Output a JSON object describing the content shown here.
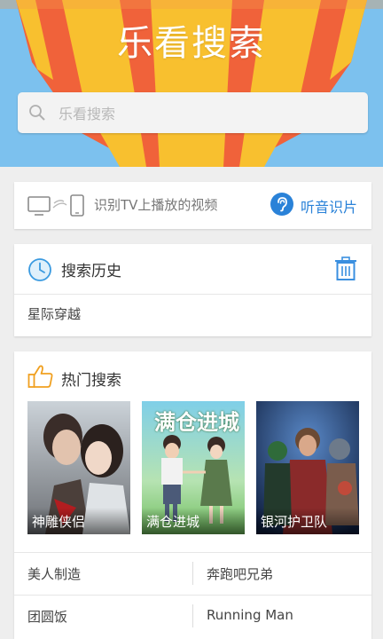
{
  "header": {
    "app_title": "乐看搜索",
    "search_placeholder": "乐看搜索"
  },
  "tv_card": {
    "text": "识别TV上播放的视频",
    "listen_label": "听音识片"
  },
  "history": {
    "title": "搜索历史",
    "items": [
      "星际穿越"
    ]
  },
  "hot": {
    "title": "热门搜索",
    "posters": [
      {
        "caption": "神雕侠侣"
      },
      {
        "caption": "满仓进城",
        "logo_text": "满仓进城"
      },
      {
        "caption": "银河护卫队"
      }
    ],
    "terms": [
      "美人制造",
      "奔跑吧兄弟",
      "团圆饭",
      "Running Man"
    ]
  },
  "colors": {
    "accent_blue": "#2a82d8",
    "sky": "#7cc1ee",
    "balloon_orange": "#f0623a",
    "balloon_yellow": "#f8c02f"
  }
}
